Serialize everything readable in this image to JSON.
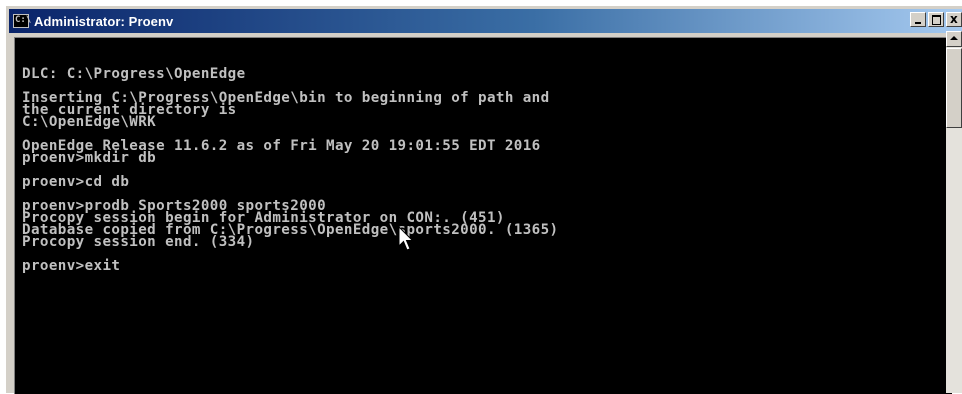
{
  "window": {
    "title": "Administrator: Proenv",
    "close_glyph": "x"
  },
  "console": {
    "lines": [
      "DLC: C:\\Progress\\OpenEdge",
      "",
      "Inserting C:\\Progress\\OpenEdge\\bin to beginning of path and",
      "the current directory is",
      "C:\\OpenEdge\\WRK",
      "",
      "OpenEdge Release 11.6.2 as of Fri May 20 19:01:55 EDT 2016",
      "proenv>mkdir db",
      "",
      "proenv>cd db",
      "",
      "proenv>prodb Sports2000 sports2000",
      "Procopy session begin for Administrator on CON:. (451)",
      "Database copied from C:\\Progress\\OpenEdge\\sports2000. (1365)",
      "Procopy session end. (334)",
      "",
      "proenv>exit"
    ]
  },
  "colors": {
    "console_bg": "#000000",
    "console_text": "#c0c0c0",
    "titlebar_start": "#0a246a",
    "titlebar_end": "#a6caf0"
  },
  "icons": {
    "title": "console-app-icon",
    "minimize": "minimize-icon",
    "maximize": "maximize-icon",
    "close": "close-icon",
    "pointer": "mouse-pointer-icon"
  }
}
